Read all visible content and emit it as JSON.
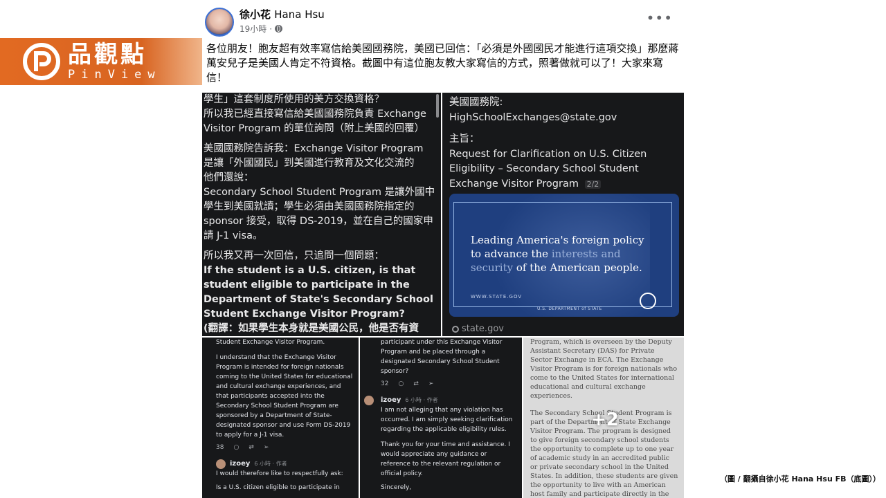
{
  "brand": {
    "name_zh": "品觀點",
    "name_en": "PinView",
    "color": "#e26a22"
  },
  "post": {
    "author_zh": "徐小花",
    "author_en": "Hana Hsu",
    "time": "19小時",
    "separator": "·",
    "more_label": "•••",
    "text": "各位朋友！胞友超有效率寫信給美國國務院，美國已回信：「必須是外國國民才能進行這項交換」那麼蔣萬安兒子是美國人肯定不符資格。截圖中有這位胞友教大家寫信的方式，照著做就可以了！大家來寫信！"
  },
  "tile1": {
    "line1": "學生」這套制度所使用的美方交換資格？",
    "line2": "所以我已經直接寫信給美國國務院負責 Exchange Visitor Program 的單位詢問（附上美國的回覆）",
    "line3": "美國國務院告訴我：Exchange Visitor Program 是讓「外國國民」到美國進行教育及文化交流的",
    "line4": "他們還說：",
    "line5": "Secondary School Student Program 是讓外國中學生到美國就讀；學生必須由美國國務院指定的 sponsor 接受，取得 DS-2019，並在自己的國家申請 J-1 visa。",
    "line6": "所以我又再一次回信，只追問一個問題：",
    "line7": "If the student is a U.S. citizen, is that student eligible to participate in the Department of State's Secondary School Student Exchange Visitor Program?",
    "line8": "(翻譯：如果學生本身就是美國公民，他是否有資"
  },
  "tile2": {
    "to_label": "美國國務院:",
    "to_email": "HighSchoolExchanges@state.gov",
    "subject_label": "主旨：",
    "subject": "Request for Clarification on U.S. Citizen Eligibility – Secondary School Student Exchange Visitor Program",
    "page": "2/2",
    "card_line_a": "Leading America's foreign policy to advance the ",
    "card_line_b": "interests and security",
    "card_line_c": " of the American people.",
    "card_url": "WWW.STATE.GOV",
    "card_sub": "U.S. DEPARTMENT of STATE",
    "source": "state.gov"
  },
  "tile3": {
    "top": "Student Exchange Visitor Program.",
    "body": "I understand that the Exchange Visitor Program is intended for foreign nationals coming to the United States for educational and cultural exchange experiences, and that participants accepted into the Secondary School Student Program are sponsored by a Department of State-designated sponsor and use Form DS-2019 to apply for a J-1 visa.",
    "likes": "38",
    "handle": "izoey",
    "when": "6 小時 · 作者",
    "reply": "I would therefore like to respectfully ask:",
    "tail": "Is a U.S. citizen eligible to participate in"
  },
  "tile4": {
    "top": "participant under this Exchange Visitor Program and be placed through a designated Secondary School Student sponsor?",
    "likes": "32",
    "handle": "izoey",
    "when": "6 小時 · 作者",
    "body1": "I am not alleging that any violation has occurred. I am simply seeking clarification regarding the applicable eligibility rules.",
    "body2": "Thank you for your time and assistance. I would appreciate any guidance or reference to the relevant regulation or official policy.",
    "tail": "Sincerely,"
  },
  "tile5": {
    "p1": "Program, which is overseen by the Deputy Assistant Secretary (DAS) for Private Sector Exchange in ECA. The Exchange Visitor Program is for foreign nationals who come to the United States for international educational and cultural exchange experiences.",
    "p2": "The Secondary School Student Program is part of the Department of State Exchange Visitor Program. The program is designed to give foreign secondary school students the opportunity to complete up to one year of academic study in an accredited public or private secondary school in the United States. In addition, these students are given the opportunity to live with an American host family and participate directly in the home life",
    "more_count": "+2"
  },
  "caption": "（圖 / 翻攝自徐小花 Hana Hsu FB（底圖））"
}
